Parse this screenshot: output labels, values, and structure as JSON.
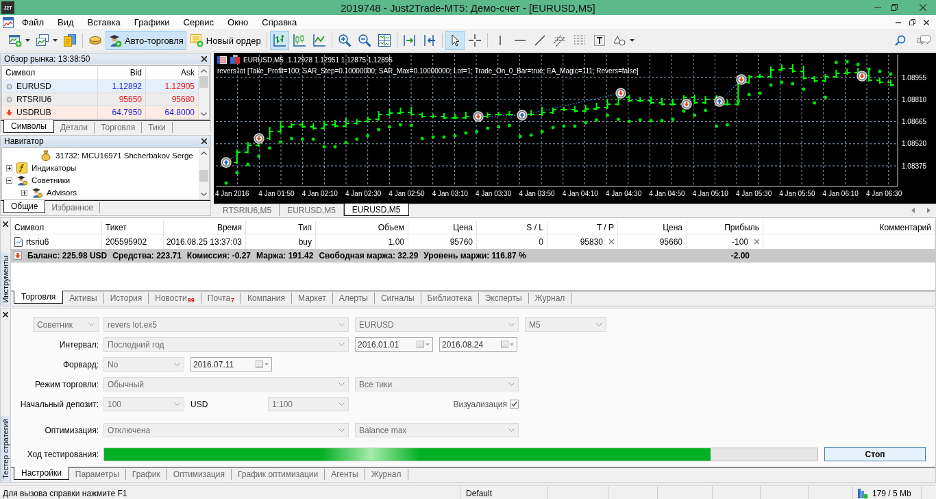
{
  "window": {
    "logo": "J2T",
    "title": "2019748 - Just2Trade-MT5: Демо-счет - [EURUSD,M5]"
  },
  "menu": [
    "Файл",
    "Вид",
    "Вставка",
    "Графики",
    "Сервис",
    "Окно",
    "Справка"
  ],
  "toolbar": {
    "auto_trading": {
      "label": "Авто-торговля",
      "on": true
    },
    "new_order": "Новый ордер",
    "chart_types": [
      {
        "selected": true
      },
      {
        "selected": false
      },
      {
        "selected": false
      }
    ],
    "pointer_tools": [
      {
        "selected": true
      },
      {
        "selected": false
      }
    ]
  },
  "market_watch": {
    "title": "Обзор рынка: 13:38:50",
    "columns": [
      "Символ",
      "Bid",
      "Ask"
    ],
    "rows": [
      {
        "symbol": "EURUSD",
        "bid": {
          "value": "1.12892",
          "color": "#1b1bd6"
        },
        "ask": {
          "value": "1.12905",
          "color": "#f01414"
        },
        "falling": false,
        "selected": true
      },
      {
        "symbol": "RTSRIU6",
        "bid": {
          "value": "95650",
          "color": "#f01414"
        },
        "ask": {
          "value": "95680",
          "color": "#f01414"
        },
        "falling": false,
        "selected": false
      },
      {
        "symbol": "USDRUB",
        "bid": {
          "value": "64.7950",
          "color": "#1b1bd6"
        },
        "ask": {
          "value": "64.8000",
          "color": "#1b1bd6"
        },
        "falling": true,
        "selected": false
      }
    ],
    "tabs": [
      {
        "label": "Символы",
        "selected": true
      },
      {
        "label": "Детали",
        "selected": false
      },
      {
        "label": "Торговля",
        "selected": false
      },
      {
        "label": "Тики",
        "selected": false
      }
    ]
  },
  "navigator": {
    "title": "Навигатор",
    "tree": [
      {
        "label": "31732: MCU16971 Shcherbakov Serge",
        "kind": "account"
      },
      {
        "label": "Индикаторы",
        "kind": "indicators",
        "expanded": false
      },
      {
        "label": "Советники",
        "kind": "experts",
        "expanded": true,
        "children": [
          {
            "label": "Advisors",
            "kind": "experts",
            "expanded": false
          }
        ]
      }
    ],
    "tabs": [
      {
        "label": "Общие",
        "selected": true
      },
      {
        "label": "Избранное",
        "selected": false
      }
    ]
  },
  "chart": {
    "symbol": "EURUSD,M5",
    "prices": "1.12928 1.12951 1.12875 1.12895",
    "expert": "revers lot [Take_Profit=100; SAR_Step=0.10000000; SAR_Max=0.10000000; Lot=1; Trade_On_0_Bar=true; EA_Magic=111; Revers=false]",
    "price_axis": [
      "1.08955",
      "1.08810",
      "1.08665",
      "1.08520",
      "1.08375"
    ],
    "time_axis": [
      "4 Jan 2016",
      "4 Jan 01:50",
      "4 Jan 02:10",
      "4 Jan 02:30",
      "4 Jan 02:50",
      "4 Jan 03:10",
      "4 Jan 03:30",
      "4 Jan 03:50",
      "4 Jan 04:10",
      "4 Jan 04:30",
      "4 Jan 04:50",
      "4 Jan 05:10",
      "4 Jan 05:30",
      "4 Jan 05:50",
      "4 Jan 06:10",
      "4 Jan 06:30"
    ]
  },
  "chart_tabs": [
    {
      "label": "RTSRIU6,M5",
      "selected": false
    },
    {
      "label": "EURUSD,M5",
      "selected": false
    },
    {
      "label": "EURUSD,M5",
      "selected": true
    }
  ],
  "toolbox": {
    "title": "Инструменты",
    "columns": [
      "Символ",
      "Тикет",
      "Время",
      "Тип",
      "Объем",
      "Цена",
      "S / L",
      "T / P",
      "Цена",
      "Прибыль",
      "Комментарий"
    ],
    "rows": [
      {
        "symbol": "rtsriu6",
        "ticket": "205595902",
        "time": "2016.08.25 13:37:03",
        "type": "buy",
        "volume": "1.00",
        "price": "95760",
        "sl": "0",
        "tp": "95830",
        "current": "95660",
        "profit": "-100"
      }
    ],
    "summary": {
      "items": [
        "Баланс: 225.98 USD",
        "Средства: 223.71",
        "Комиссия: -0.27",
        "Маржа: 191.42",
        "Свободная маржа: 32.29",
        "Уровень маржи: 116.87 %"
      ],
      "profit": "-2.00"
    },
    "tabs": [
      {
        "label": "Торговля",
        "selected": true
      },
      {
        "label": "Активы",
        "selected": false
      },
      {
        "label": "История",
        "selected": false
      },
      {
        "label": "Новости",
        "badge": "99",
        "selected": false
      },
      {
        "label": "Почта",
        "badge": "7",
        "selected": false
      },
      {
        "label": "Компания",
        "selected": false
      },
      {
        "label": "Маркет",
        "selected": false
      },
      {
        "label": "Алерты",
        "selected": false
      },
      {
        "label": "Сигналы",
        "selected": false
      },
      {
        "label": "Библиотека",
        "selected": false
      },
      {
        "label": "Эксперты",
        "selected": false
      },
      {
        "label": "Журнал",
        "selected": false
      }
    ]
  },
  "tester": {
    "title": "Тестер стратегий",
    "disabled": true,
    "mode": "Советник",
    "expert": "revers lot.ex5",
    "symbol": "EURUSD",
    "period": "M5",
    "interval": {
      "label": "Интервал:",
      "value": "Последний год",
      "from": "2016.01.01",
      "to": "2016.08.24"
    },
    "forward": {
      "label": "Форвард:",
      "value": "No",
      "date": "2016.07.11"
    },
    "trade_mode": {
      "label": "Режим торговли:",
      "value": "Обычный",
      "ticks": "Все тики"
    },
    "deposit": {
      "label": "Начальный депозит:",
      "value": "100",
      "currency": "USD",
      "leverage": "1:100"
    },
    "visualization": {
      "label": "Визуализация",
      "checked": true
    },
    "optimization": {
      "label": "Оптимизация:",
      "value": "Отключена",
      "criterion": "Balance max"
    },
    "progress": {
      "label": "Ход тестирования:",
      "level": 0.85
    },
    "stop": "Стоп",
    "tabs": [
      {
        "label": "Настройки",
        "selected": true
      },
      {
        "label": "Параметры",
        "selected": false
      },
      {
        "label": "График",
        "selected": false
      },
      {
        "label": "Оптимизация",
        "selected": false
      },
      {
        "label": "График оптимизации",
        "selected": false
      },
      {
        "label": "Агенты",
        "selected": false
      },
      {
        "label": "Журнал",
        "selected": false
      }
    ]
  },
  "status_bar": {
    "hint": "Для вызова справки нажмите F1",
    "profile": "Default",
    "traffic": "179 / 5 Mb"
  }
}
